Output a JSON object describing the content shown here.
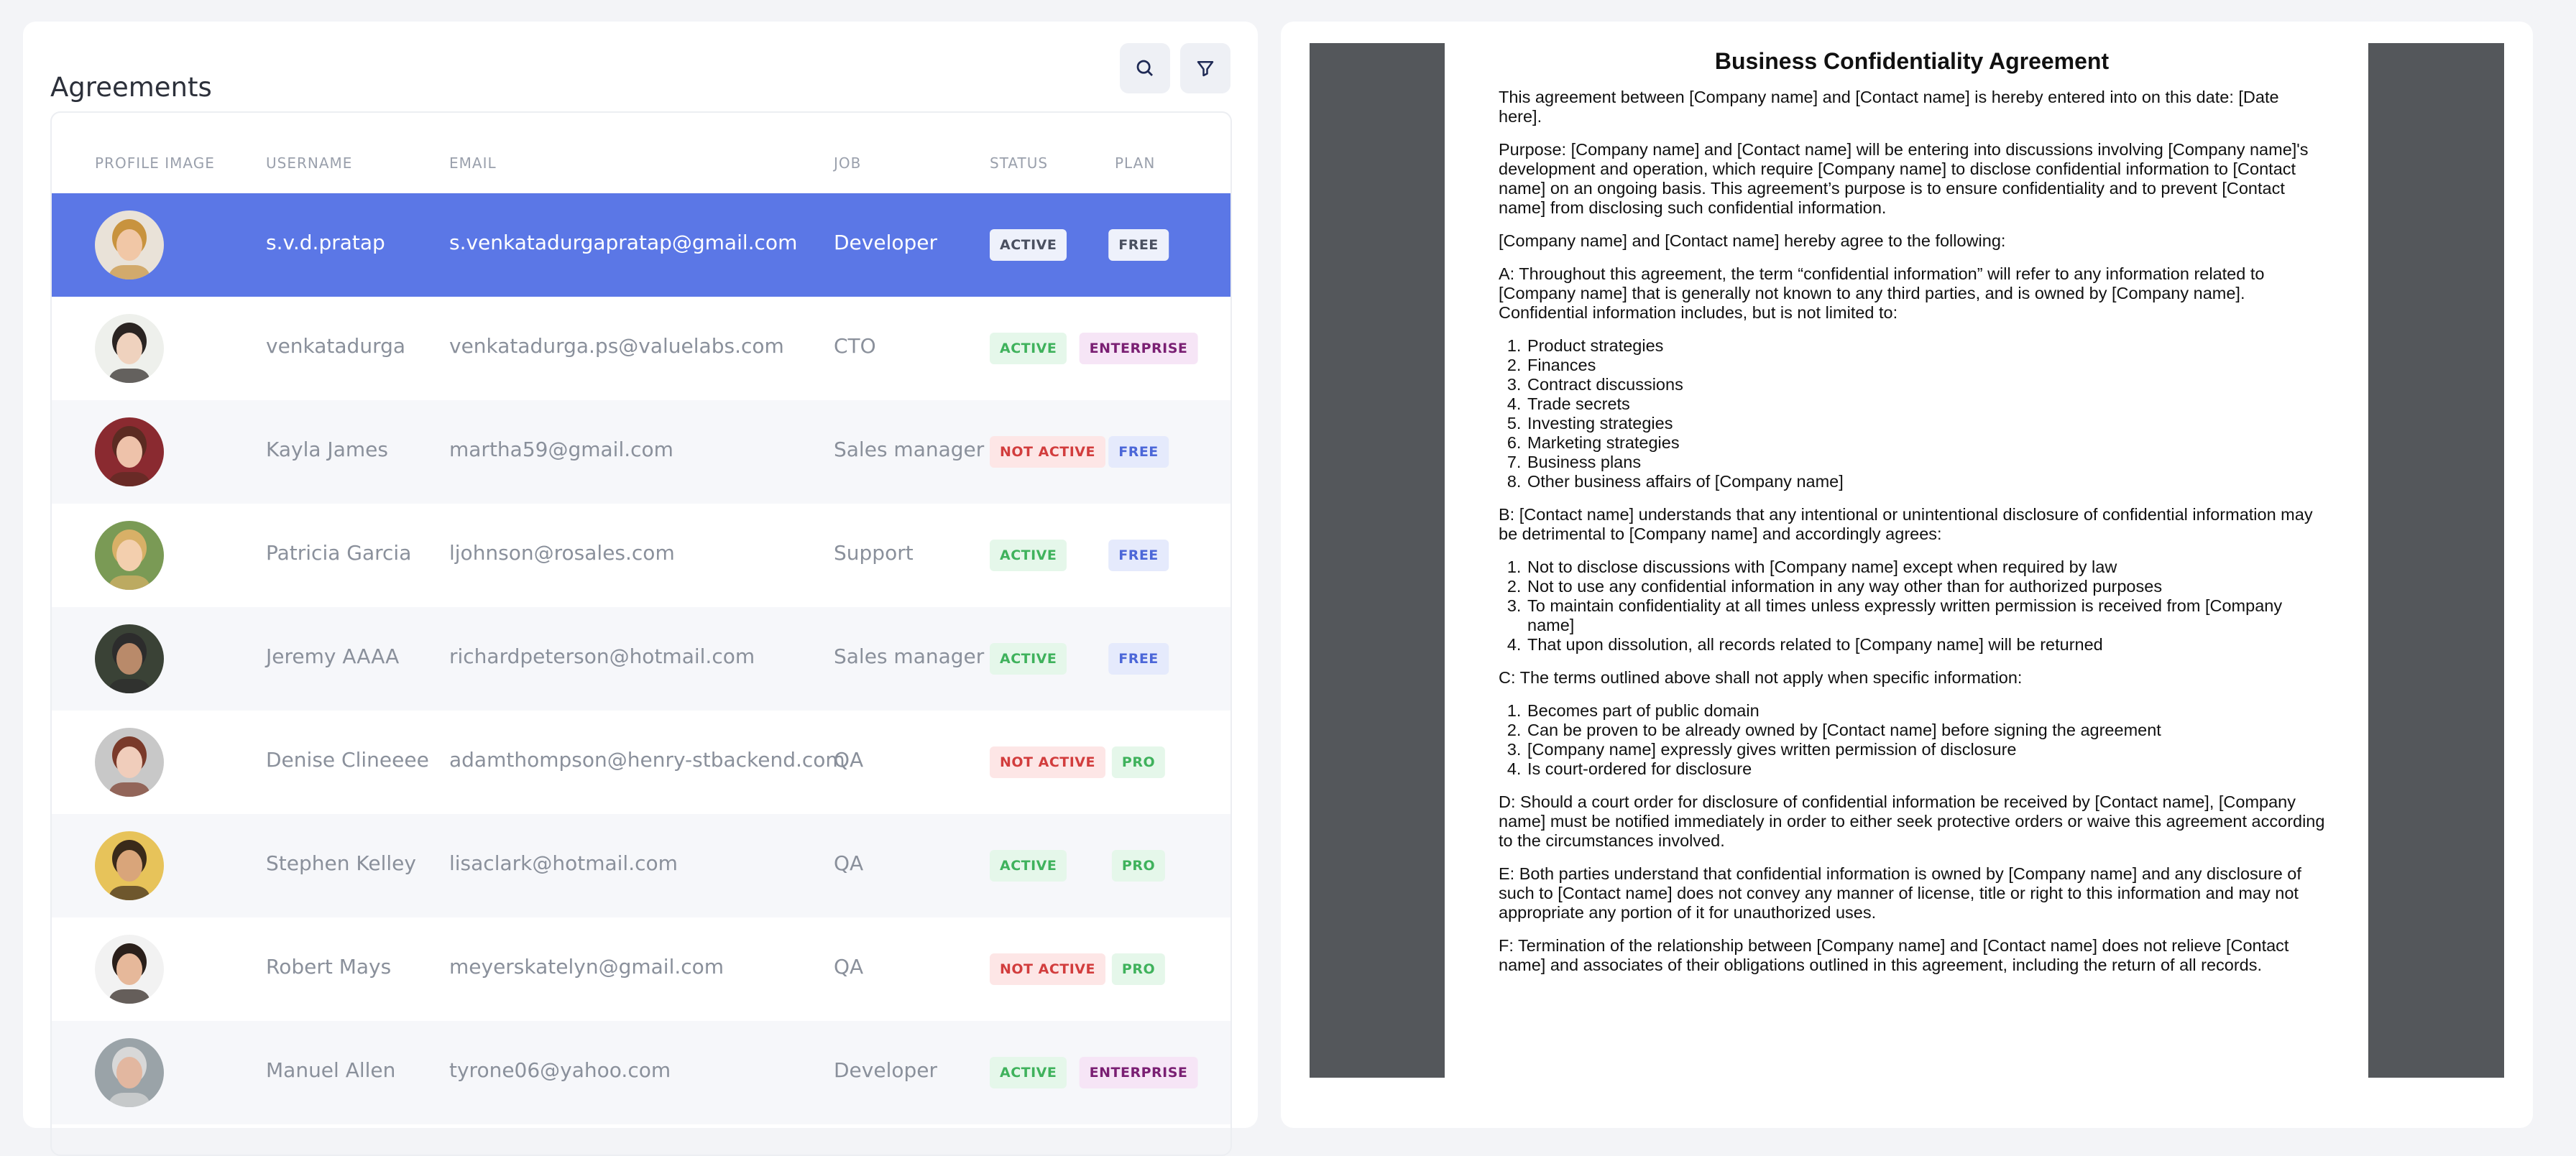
{
  "panel": {
    "title": "Agreements"
  },
  "columns": [
    "PROFILE IMAGE",
    "USERNAME",
    "EMAIL",
    "JOB",
    "STATUS",
    "PLAN"
  ],
  "rows": [
    {
      "username": "s.v.d.pratap",
      "email": "s.venkatadurgapratap@gmail.com",
      "job": "Developer",
      "status": "ACTIVE",
      "plan": "FREE",
      "skin": "#f1c7a6",
      "hair": "#c8933e",
      "bg": "#e9e2d8"
    },
    {
      "username": "venkatadurga",
      "email": "venkatadurga.ps@valuelabs.com",
      "job": "CTO",
      "status": "ACTIVE",
      "plan": "ENTERPRISE",
      "skin": "#efd2be",
      "hair": "#2a2422",
      "bg": "#eef0ec"
    },
    {
      "username": "Kayla James",
      "email": "martha59@gmail.com",
      "job": "Sales manager",
      "status": "NOT ACTIVE",
      "plan": "FREE",
      "skin": "#eec2aa",
      "hair": "#5b2b22",
      "bg": "#8a2a30"
    },
    {
      "username": "Patricia Garcia",
      "email": "ljohnson@rosales.com",
      "job": "Support",
      "status": "ACTIVE",
      "plan": "FREE",
      "skin": "#f3cfae",
      "hair": "#d8b067",
      "bg": "#7a9a55"
    },
    {
      "username": "Jeremy AAAA",
      "email": "richardpeterson@hotmail.com",
      "job": "Sales manager",
      "status": "ACTIVE",
      "plan": "FREE",
      "skin": "#b98a6a",
      "hair": "#2c2c2c",
      "bg": "#3a4236"
    },
    {
      "username": "Denise Clineeee",
      "email": "adamthompson@henry-stbackend.com",
      "job": "QA",
      "status": "NOT ACTIVE",
      "plan": "PRO",
      "skin": "#f0cdbb",
      "hair": "#7a3a2a",
      "bg": "#c8c8c8"
    },
    {
      "username": "Stephen Kelley",
      "email": "lisaclark@hotmail.com",
      "job": "QA",
      "status": "ACTIVE",
      "plan": "PRO",
      "skin": "#d9a57a",
      "hair": "#3a2a1a",
      "bg": "#e7c35a"
    },
    {
      "username": "Robert Mays",
      "email": "meyerskatelyn@gmail.com",
      "job": "QA",
      "status": "NOT ACTIVE",
      "plan": "PRO",
      "skin": "#e6b89a",
      "hair": "#2a1f1a",
      "bg": "#f2f2f2"
    },
    {
      "username": "Manuel Allen",
      "email": "tyrone06@yahoo.com",
      "job": "Developer",
      "status": "ACTIVE",
      "plan": "ENTERPRISE",
      "skin": "#e2b7a0",
      "hair": "#d8d8d8",
      "bg": "#9aa3a8"
    }
  ],
  "document": {
    "title": "Business Confidentiality Agreement",
    "intro": "This agreement between [Company name] and [Contact name]  is hereby entered into on this date: [Date here].",
    "purpose": "Purpose: [Company name] and [Contact name] will be entering into discussions involving [Company name]'s development and operation, which require [Company name] to disclose confidential information to [Contact name] on an ongoing basis. This agreement’s purpose is to ensure confidentiality and to prevent [Contact name] from disclosing such confidential information.",
    "agree": "[Company name] and [Contact name] hereby agree to the following:",
    "sectionA": "A: Throughout this agreement, the term “confidential information” will refer to any information related to [Company name] that is generally not known to any third parties, and is owned by [Company name]. Confidential information includes, but is not limited to:",
    "listA": [
      "Product strategies",
      "Finances",
      "Contract discussions",
      "Trade secrets",
      "Investing strategies",
      "Marketing strategies",
      "Business plans",
      "Other business affairs of [Company name]"
    ],
    "sectionB": "B: [Contact name] understands that any intentional or unintentional disclosure of confidential information may be detrimental to [Company name] and accordingly agrees:",
    "listB": [
      "Not to disclose discussions with [Company name] except when required by law",
      "Not to use any confidential information in any way other than for authorized purposes",
      "To maintain confidentiality at all times unless expressly written permission is received from [Company name]",
      "That upon dissolution, all records related to [Company name] will be returned"
    ],
    "sectionC": "C: The terms outlined above shall not apply when specific information:",
    "listC": [
      "Becomes part of public domain",
      "Can be proven to be already owned by [Contact name] before signing the agreement",
      "[Company name] expressly gives written permission of disclosure",
      "Is court-ordered for disclosure"
    ],
    "sectionD": "D: Should a court order for disclosure of confidential information be received by [Contact name], [Company name] must be notified immediately in order to either seek protective orders or waive this agreement according to the circumstances involved.",
    "sectionE": "E: Both parties understand that confidential information is owned by [Company name] and any disclosure of such to [Contact name] does not convey any manner of license, title or right to this information and may not appropriate any portion of it for unauthorized uses.",
    "sectionF": "F: Termination of the relationship between [Company name] and [Contact name] does not relieve [Contact name] and associates of their obligations outlined in this agreement, including the return of all records."
  }
}
